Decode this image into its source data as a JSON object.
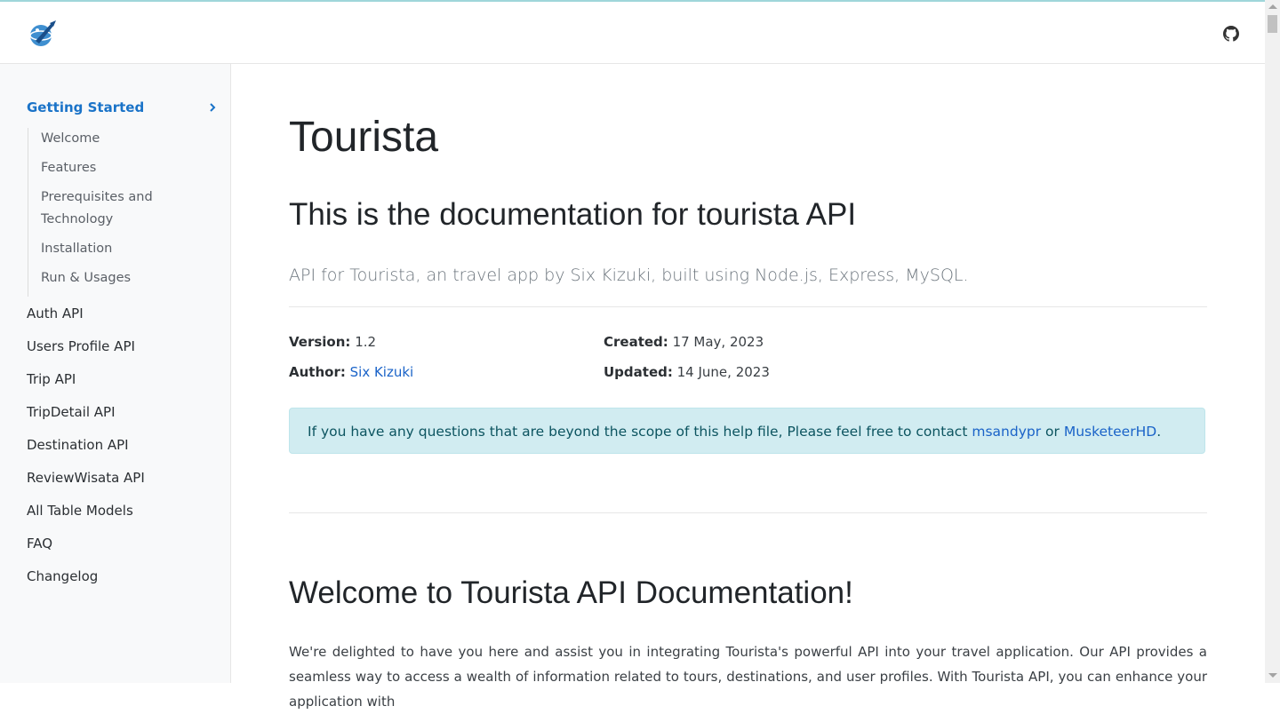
{
  "header": {
    "logo_icon": "rocket-globe-logo",
    "github_icon": "github-icon"
  },
  "sidebar": {
    "group_title": "Getting Started",
    "sub_items": [
      {
        "label": "Welcome"
      },
      {
        "label": "Features"
      },
      {
        "label": "Prerequisites and Technology"
      },
      {
        "label": "Installation"
      },
      {
        "label": "Run & Usages"
      }
    ],
    "top_items": [
      {
        "label": "Auth API"
      },
      {
        "label": "Users Profile API"
      },
      {
        "label": "Trip API"
      },
      {
        "label": "TripDetail API"
      },
      {
        "label": "Destination API"
      },
      {
        "label": "ReviewWisata API"
      },
      {
        "label": "All Table Models"
      },
      {
        "label": "FAQ"
      },
      {
        "label": "Changelog"
      }
    ]
  },
  "main": {
    "title": "Tourista",
    "subtitle": "This is the documentation for tourista API",
    "lead": "API for Tourista, an travel app by Six Kizuki, built using Node.js, Express, MySQL.",
    "meta": {
      "version_label": "Version:",
      "version_value": "1.2",
      "author_label": "Author:",
      "author_value": "Six Kizuki",
      "created_label": "Created:",
      "created_value": "17 May, 2023",
      "updated_label": "Updated:",
      "updated_value": "14 June, 2023"
    },
    "alert": {
      "text_before": "If you have any questions that are beyond the scope of this help file, Please feel free to contact",
      "link1": "msandypr",
      "text_mid": "or",
      "link2": "MusketeerHD",
      "text_after": "."
    },
    "welcome_heading": "Welcome to Tourista API Documentation!",
    "welcome_paragraph": "We're delighted to have you here and assist you in integrating Tourista's powerful API into your travel application. Our API provides a seamless way to access a wealth of information related to tours, destinations, and user profiles. With Tourista API, you can enhance your application with"
  },
  "colors": {
    "accent": "#1a73c8",
    "alert_bg": "#d1ecf1"
  }
}
